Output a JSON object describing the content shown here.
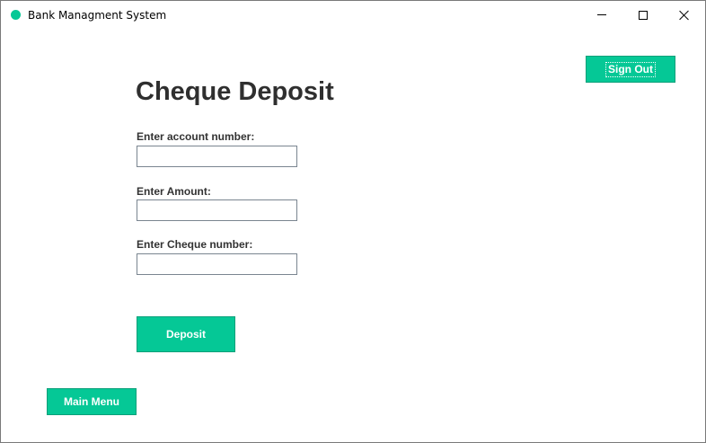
{
  "window": {
    "title": "Bank Managment System",
    "accent_color": "#05c896"
  },
  "header": {
    "sign_out_label": "Sign Out"
  },
  "form": {
    "title": "Cheque Deposit",
    "account_label": "Enter account number:",
    "account_value": "",
    "amount_label": "Enter Amount:",
    "amount_value": "",
    "cheque_label": "Enter Cheque number:",
    "cheque_value": "",
    "deposit_label": "Deposit"
  },
  "footer": {
    "main_menu_label": "Main Menu"
  },
  "icons": {
    "app": "app-dot-icon",
    "minimize": "minimize-icon",
    "maximize": "maximize-icon",
    "close": "close-icon"
  }
}
